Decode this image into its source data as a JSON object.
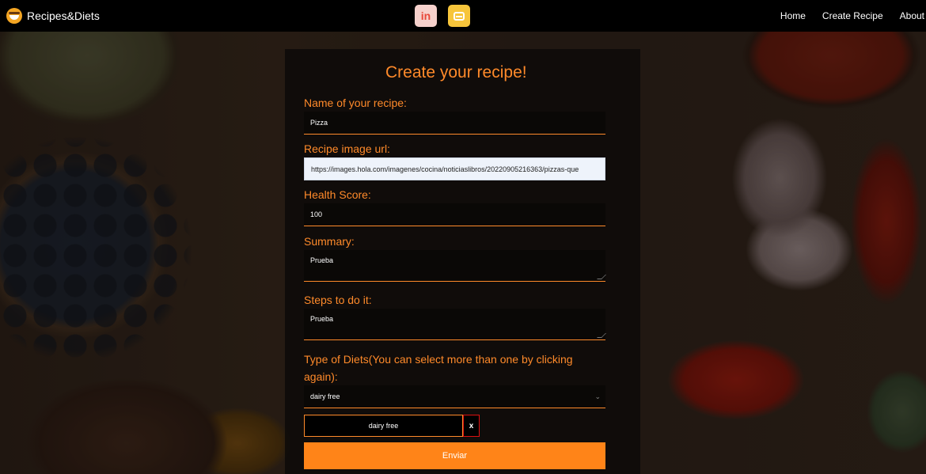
{
  "navbar": {
    "brand": "Recipes&Diets",
    "social": [
      {
        "icon": "linkedin-icon",
        "glyph": "in",
        "color": "#e8483a"
      },
      {
        "icon": "github-icon",
        "color": "#f7c53b"
      }
    ],
    "links": [
      "Home",
      "Create Recipe",
      "About"
    ]
  },
  "form": {
    "title": "Create your recipe!",
    "name_label": "Name of your recipe:",
    "name_value": "Pizza",
    "image_label": "Recipe image url:",
    "image_value": "https://images.hola.com/imagenes/cocina/noticiaslibros/20220905216363/pizzas-que",
    "health_label": "Health Score:",
    "health_value": "100",
    "summary_label": "Summary:",
    "summary_value": "Prueba",
    "steps_label": "Steps to do it:",
    "steps_value": "Prueba",
    "diets_label_line1": "Type of Diets(You can select more than one by clicking",
    "diets_label_line2": "again):",
    "diet_selected": "dairy free",
    "chips": [
      {
        "label": "dairy free",
        "remove": "x"
      }
    ],
    "submit_label": "Enviar"
  },
  "colors": {
    "accent": "#ff8a2a",
    "button": "#ff8418",
    "navbar": "#000000"
  }
}
